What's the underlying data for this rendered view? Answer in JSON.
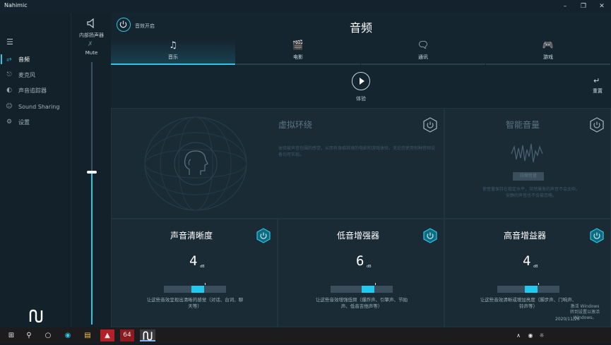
{
  "app": {
    "title": "Nahimic"
  },
  "nav": {
    "items": [
      {
        "label": "音频",
        "icon": "audio-wave-icon",
        "active": true
      },
      {
        "label": "麦克风",
        "icon": "microphone-icon",
        "active": false
      },
      {
        "label": "声音追踪器",
        "icon": "sound-tracker-icon",
        "active": false
      },
      {
        "label": "Sound Sharing",
        "icon": "headset-icon",
        "active": false
      },
      {
        "label": "设置",
        "icon": "gear-icon",
        "active": false
      }
    ]
  },
  "volume": {
    "device_label": "内部扬声器",
    "mute_label": "Mute",
    "level": 0.58
  },
  "header": {
    "power_label": "音效开启",
    "title": "音频"
  },
  "tabs": [
    {
      "label": "音乐",
      "icon": "music-note-icon",
      "active": true
    },
    {
      "label": "电影",
      "icon": "clapperboard-icon",
      "active": false
    },
    {
      "label": "通讯",
      "icon": "chat-bubble-icon",
      "active": false
    },
    {
      "label": "游戏",
      "icon": "gamepad-icon",
      "active": false
    }
  ],
  "preview": {
    "play_label": "体验",
    "reset_label": "重置"
  },
  "surround": {
    "title": "虚拟环绕",
    "description": "体验被声音包围的感觉，从而有身临其境的电影和游戏体验，无论您使用何种音频设备均可实现。"
  },
  "smart_volume": {
    "title": "智能音量",
    "button_label": "压缩音量",
    "description": "使音量保持在稳定水平，突然爆发的声音不会太响，安静的声音也不会被忽略。"
  },
  "enhancers": [
    {
      "title": "声音清晰度",
      "value": "4",
      "unit": "dB",
      "level": 0.5,
      "hint": "让这些音效呈现出清晰的感觉（对话、台词、聊天等）"
    },
    {
      "title": "低音增强器",
      "value": "6",
      "unit": "dB",
      "level": 0.75,
      "hint": "让这些音效增强低频（爆炸声、引擎声、节拍声、低音吉他声等）"
    },
    {
      "title": "高音增益器",
      "value": "4",
      "unit": "dB",
      "level": 0.5,
      "hint": "让这些音效清晰或增加亮度（脚步声、门响声、铃声等）"
    }
  ],
  "watermark": {
    "line1": "激活 Windows",
    "line2": "转到设置以激活 Windows。"
  },
  "clock": {
    "date": "2020/11/26"
  },
  "taskbar": {
    "badge": "64"
  },
  "colors": {
    "accent": "#2ec6e6",
    "background": "#152530"
  }
}
